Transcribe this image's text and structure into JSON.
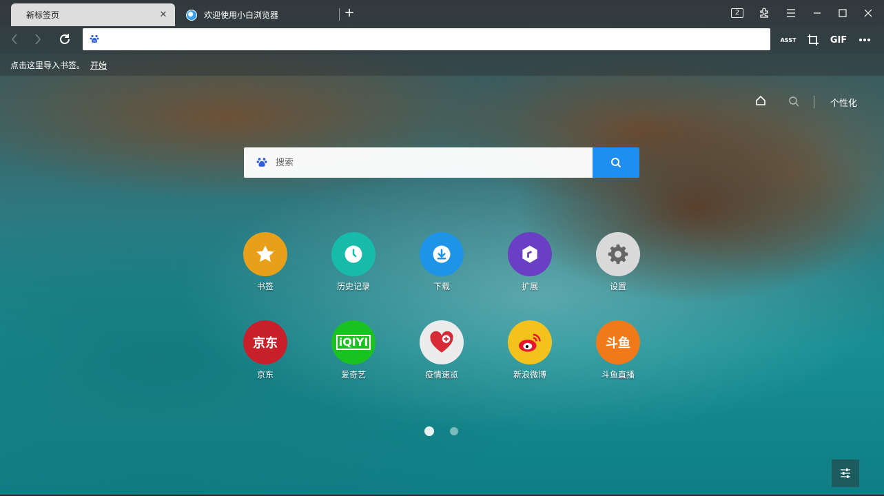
{
  "tabs": [
    {
      "title": "新标签页",
      "active": true
    },
    {
      "title": "欢迎使用小白浏览器",
      "active": false
    }
  ],
  "window": {
    "tab_count": "2"
  },
  "toolbar": {
    "address_value": "",
    "asst_label": "ASST",
    "gif_label": "GIF"
  },
  "bookmarks_bar": {
    "hint": "点击这里导入书签。",
    "start_link": "开始"
  },
  "page": {
    "personalize_label": "个性化",
    "search_placeholder": "搜索"
  },
  "shortcuts": [
    {
      "label": "书签",
      "icon": "star-icon",
      "color": "#e8a01a"
    },
    {
      "label": "历史记录",
      "icon": "clock-icon",
      "color": "#16bba9"
    },
    {
      "label": "下载",
      "icon": "download-icon",
      "color": "#1e94e8"
    },
    {
      "label": "扩展",
      "icon": "extension-hexagon-icon",
      "color": "#6a3fc4"
    },
    {
      "label": "设置",
      "icon": "gear-icon",
      "color": "#d9d9d9"
    },
    {
      "label": "京东",
      "icon": "jd-logo-icon",
      "color": "#c8202a",
      "logo_text": "京东"
    },
    {
      "label": "爱奇艺",
      "icon": "iqiyi-logo-icon",
      "color": "#19c21f",
      "logo_text": "iQIYI"
    },
    {
      "label": "疫情速览",
      "icon": "heart-plus-icon",
      "color": "#ececec"
    },
    {
      "label": "新浪微博",
      "icon": "weibo-logo-icon",
      "color": "#f4c21c"
    },
    {
      "label": "斗鱼直播",
      "icon": "douyu-logo-icon",
      "color": "#f07a1a",
      "logo_text": "斗鱼"
    }
  ],
  "pagination": {
    "pages": 2,
    "current": 1
  }
}
